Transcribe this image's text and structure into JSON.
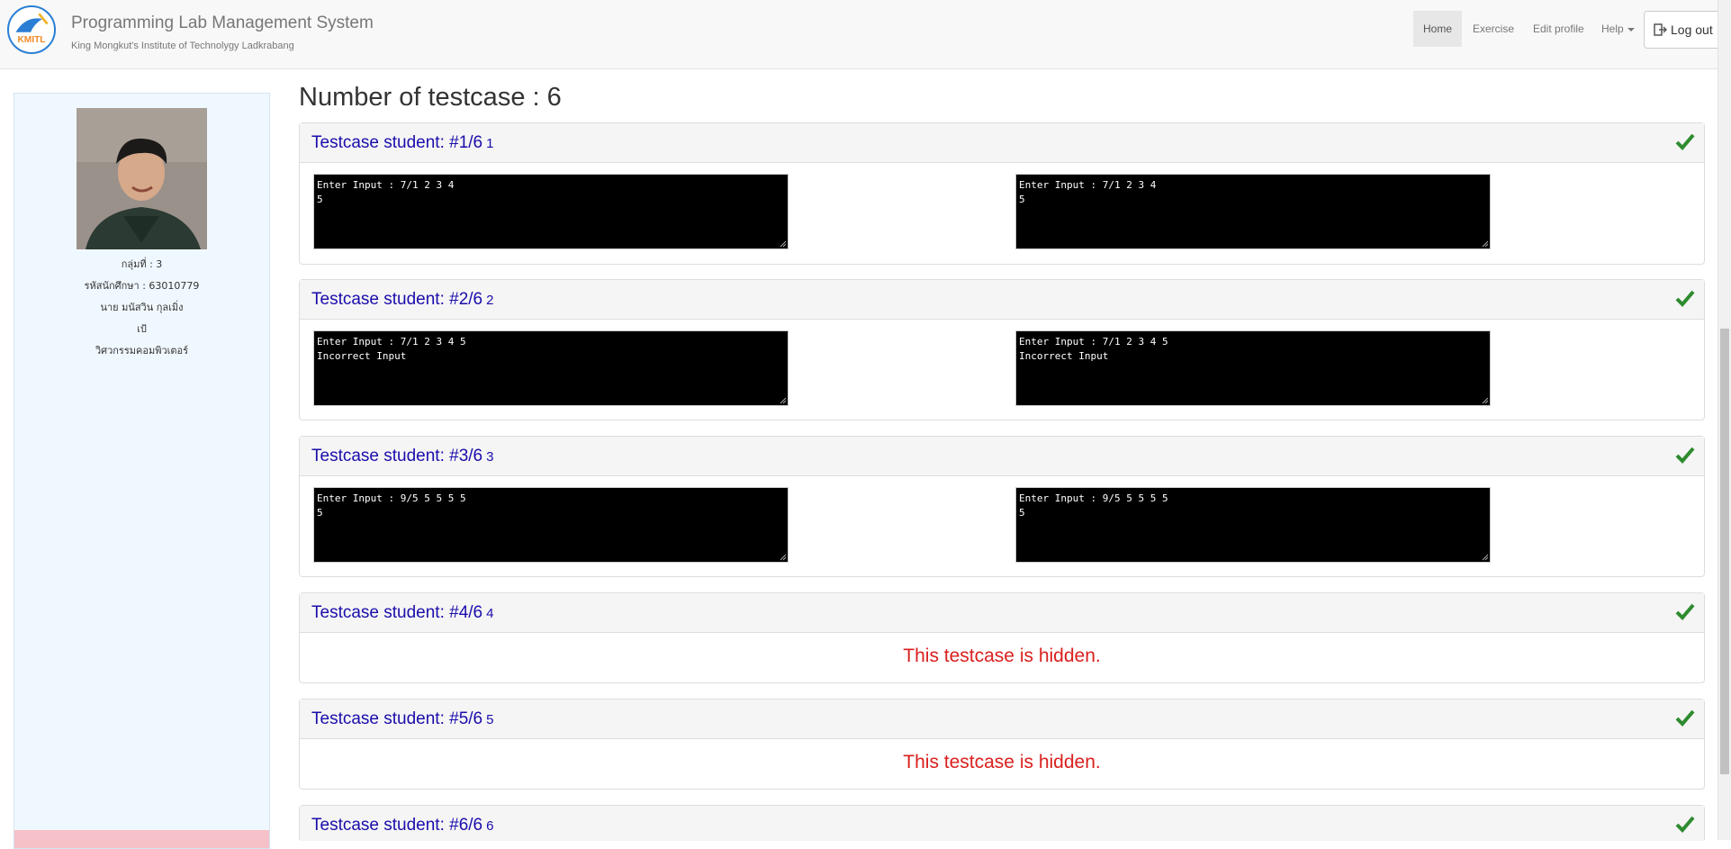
{
  "navbar": {
    "title": "Programming Lab Management System",
    "subtitle": "King Mongkut's Institute of Technolygy Ladkrabang",
    "logo_text": "KMITL",
    "items": [
      {
        "label": "Home"
      },
      {
        "label": "Exercise"
      },
      {
        "label": "Edit profile"
      },
      {
        "label": "Help"
      }
    ],
    "logout_label": "Log out"
  },
  "profile": {
    "group": "กลุ่มที่ : 3",
    "student_id": "รหัสนักศึกษา : 63010779",
    "name": "นาย มนัสวิน กุลเมิ่ง",
    "nickname": "เป้",
    "department": "วิศวกรรมคอมพิวเตอร์"
  },
  "main": {
    "title": "Number of testcase : 6",
    "hidden_text": "This testcase is hidden.",
    "testcases": [
      {
        "title": "Testcase student: #1/6",
        "num": "1",
        "expected": "Enter Input : 7/1 2 3 4\n5",
        "actual": "Enter Input : 7/1 2 3 4\n5"
      },
      {
        "title": "Testcase student: #2/6",
        "num": "2",
        "expected": "Enter Input : 7/1 2 3 4 5\nIncorrect Input",
        "actual": "Enter Input : 7/1 2 3 4 5\nIncorrect Input"
      },
      {
        "title": "Testcase student: #3/6",
        "num": "3",
        "expected": "Enter Input : 9/5 5 5 5 5\n5",
        "actual": "Enter Input : 9/5 5 5 5 5\n5"
      },
      {
        "title": "Testcase student: #4/6",
        "num": "4"
      },
      {
        "title": "Testcase student: #5/6",
        "num": "5"
      },
      {
        "title": "Testcase student: #6/6",
        "num": "6"
      }
    ]
  },
  "colors": {
    "title_link": "#1a0dab",
    "check": "#2e8b2e",
    "hidden": "#d9201d",
    "sidebar_bg": "#f0f8ff"
  }
}
